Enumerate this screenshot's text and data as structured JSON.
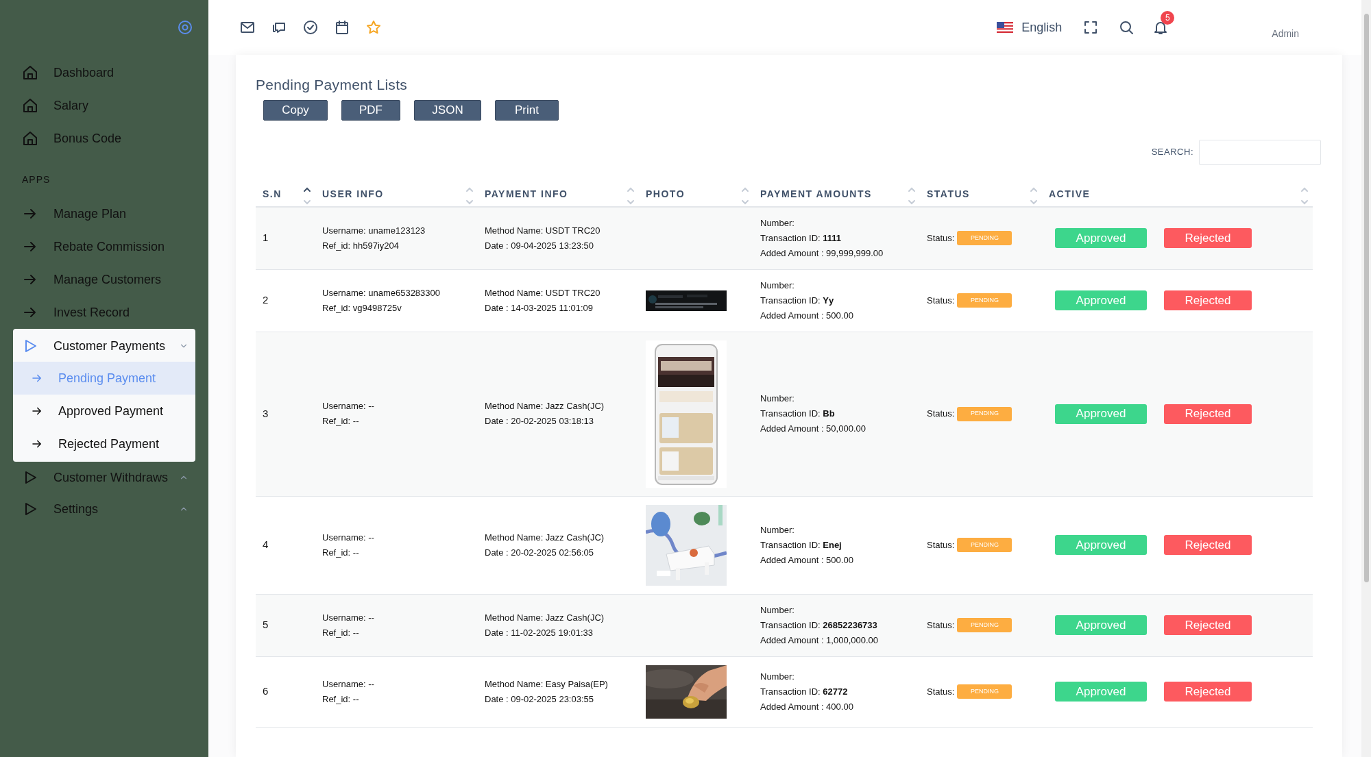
{
  "sidebar": {
    "menu": [
      {
        "kind": "home",
        "label": "Dashboard",
        "selected": false
      },
      {
        "kind": "home",
        "label": "Salary",
        "selected": false
      },
      {
        "kind": "home",
        "label": "Bonus Code",
        "selected": false
      },
      {
        "kind": "heading",
        "label": "APPS"
      },
      {
        "kind": "link",
        "label": "Manage Plan",
        "selected": false
      },
      {
        "kind": "link",
        "label": "Rebate Commission",
        "selected": false
      },
      {
        "kind": "link",
        "label": "Manage Customers",
        "selected": false
      },
      {
        "kind": "link",
        "label": "Invest Record",
        "selected": false
      },
      {
        "kind": "group",
        "label": "Customer Payments",
        "expanded": true,
        "children": [
          {
            "label": "Pending Payment",
            "selected": true
          },
          {
            "label": "Approved Payment",
            "selected": false
          },
          {
            "label": "Rejected Payment",
            "selected": false
          }
        ]
      },
      {
        "kind": "group",
        "label": "Customer Withdraws",
        "expanded": false
      },
      {
        "kind": "group",
        "label": "Settings",
        "expanded": false
      }
    ]
  },
  "topbar": {
    "language": "English",
    "notifications": "5",
    "user": "Admin"
  },
  "card": {
    "title": "Pending Payment Lists",
    "export_buttons": [
      "Copy",
      "PDF",
      "JSON",
      "Print"
    ],
    "search": {
      "label": "SEARCH:"
    },
    "columns": [
      {
        "label": "S.N",
        "sorted": true
      },
      {
        "label": "USER INFO",
        "sorted": false
      },
      {
        "label": "PAYMENT INFO",
        "sorted": false
      },
      {
        "label": "PHOTO",
        "sorted": false
      },
      {
        "label": "PAYMENT AMOUNTS",
        "sorted": false
      },
      {
        "label": "STATUS",
        "sorted": false
      },
      {
        "label": "ACTIVE",
        "sorted": false
      }
    ],
    "rows": [
      {
        "sn": "1",
        "username": "Username: uname123123",
        "ref_id": "Ref_id: hh597iy204",
        "method": "Method Name: USDT TRC20",
        "date": "Date : 09-04-2025 13:23:50",
        "number": "Number:",
        "transaction": "Transaction ID: **1111**",
        "amount": "Added Amount : 99,999,999.00",
        "status_label": "Status:",
        "status": "PENDING",
        "approve": "Approved",
        "reject": "Rejected"
      },
      {
        "sn": "2",
        "username": "Username: uname653283300",
        "ref_id": "Ref_id: vg9498725v",
        "method": "Method Name: USDT TRC20",
        "date": "Date : 14-03-2025 11:01:09",
        "number": "Number:",
        "transaction": "Transaction ID: **Yy**",
        "amount": "Added Amount : 500.00",
        "status_label": "Status:",
        "status": "PENDING",
        "approve": "Approved",
        "reject": "Rejected"
      },
      {
        "sn": "3",
        "username": "Username: --",
        "ref_id": "Ref_id: --",
        "method": "Method Name: Jazz Cash(JC)",
        "date": "Date : 20-02-2025 03:18:13",
        "number": "Number:",
        "transaction": "Transaction ID: **Bb**",
        "amount": "Added Amount : 50,000.00",
        "status_label": "Status:",
        "status": "PENDING",
        "approve": "Approved",
        "reject": "Rejected"
      },
      {
        "sn": "4",
        "username": "Username: --",
        "ref_id": "Ref_id: --",
        "method": "Method Name: Jazz Cash(JC)",
        "date": "Date : 20-02-2025 02:56:05",
        "number": "Number:",
        "transaction": "Transaction ID: **Enej**",
        "amount": "Added Amount : 500.00",
        "status_label": "Status:",
        "status": "PENDING",
        "approve": "Approved",
        "reject": "Rejected"
      },
      {
        "sn": "5",
        "username": "Username: --",
        "ref_id": "Ref_id: --",
        "method": "Method Name: Jazz Cash(JC)",
        "date": "Date : 11-02-2025 19:01:33",
        "number": "Number:",
        "transaction": "Transaction ID: **26852236733**",
        "amount": "Added Amount : 1,000,000.00",
        "status_label": "Status:",
        "status": "PENDING",
        "approve": "Approved",
        "reject": "Rejected"
      },
      {
        "sn": "6",
        "username": "Username: --",
        "ref_id": "Ref_id: --",
        "method": "Method Name: Easy Paisa(EP)",
        "date": "Date : 09-02-2025 23:03:55",
        "number": "Number:",
        "transaction": "Transaction ID: **62772**",
        "amount": "Added Amount : 400.00",
        "status_label": "Status:",
        "status": "PENDING",
        "approve": "Approved",
        "reject": "Rejected"
      }
    ]
  }
}
